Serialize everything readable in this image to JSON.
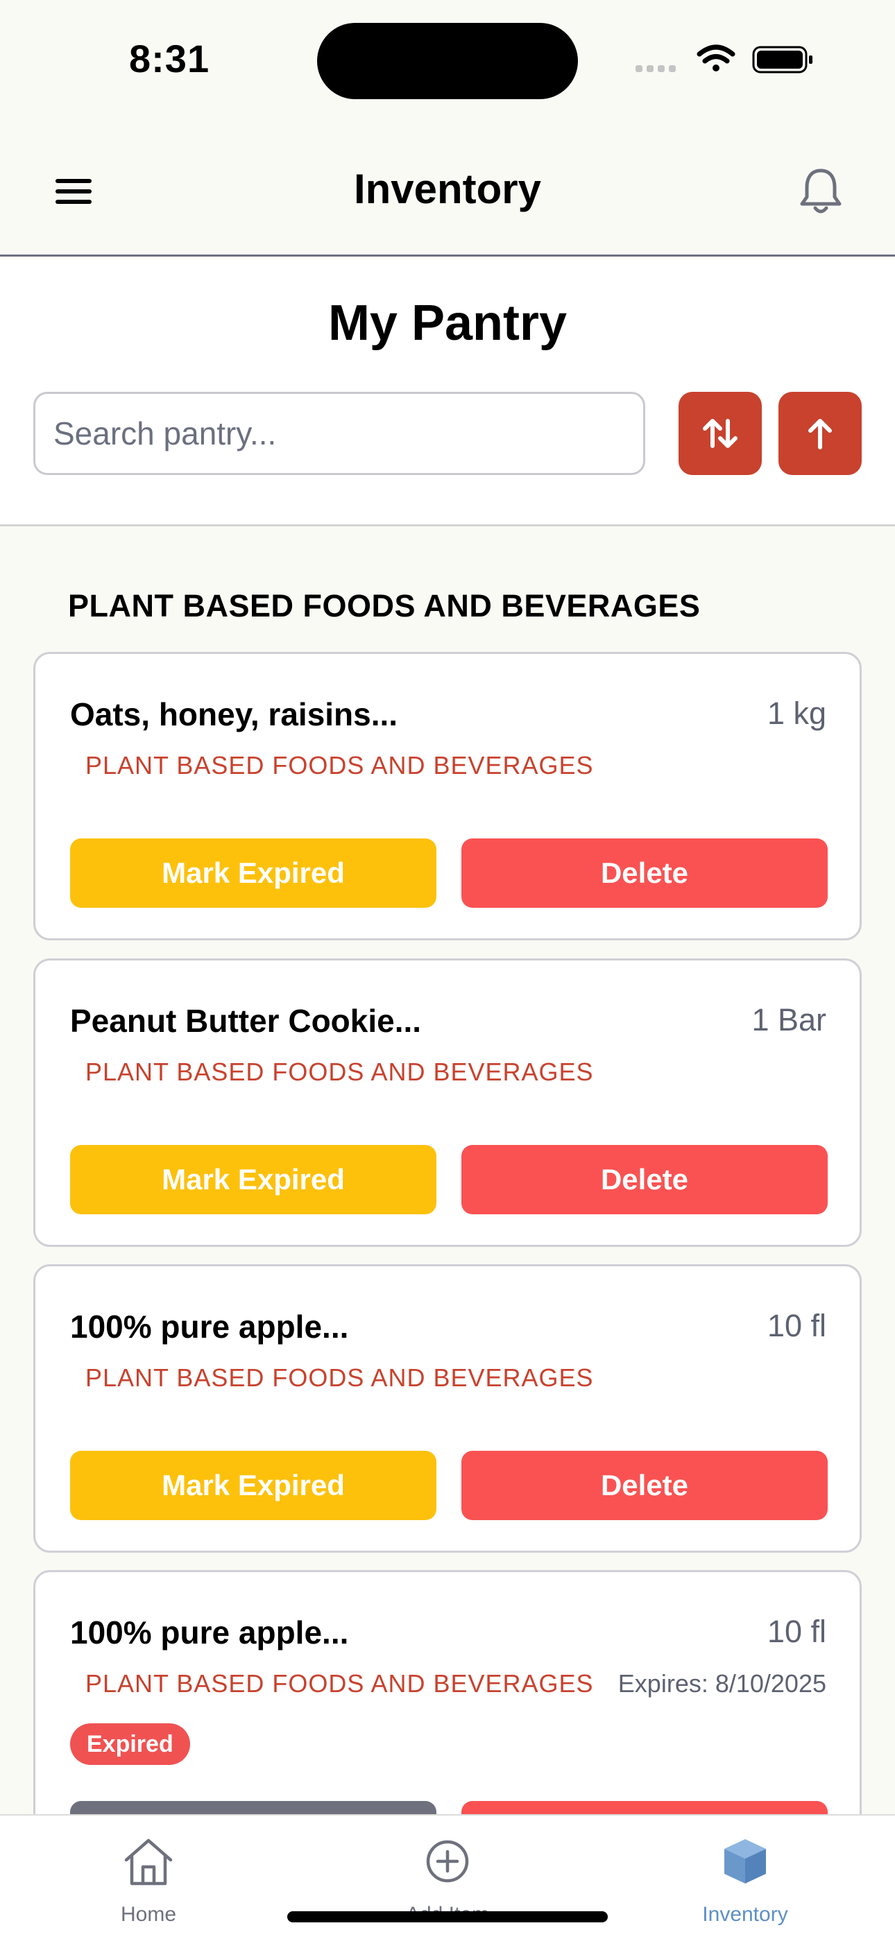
{
  "status_bar": {
    "time": "8:31"
  },
  "header": {
    "title": "Inventory"
  },
  "page": {
    "title": "My Pantry"
  },
  "search": {
    "placeholder": "Search pantry..."
  },
  "section": {
    "heading": "PLANT BASED FOODS AND BEVERAGES"
  },
  "items": [
    {
      "name": "Oats, honey, raisins...",
      "quantity": "1 kg",
      "category": "PLANT BASED FOODS AND BEVERAGES",
      "expire_label": "Mark Expired",
      "delete_label": "Delete"
    },
    {
      "name": "Peanut Butter Cookie...",
      "quantity": "1 Bar",
      "category": "PLANT BASED FOODS AND BEVERAGES",
      "expire_label": "Mark Expired",
      "delete_label": "Delete"
    },
    {
      "name": "100% pure apple...",
      "quantity": "10 fl",
      "category": "PLANT BASED FOODS AND BEVERAGES",
      "expire_label": "Mark Expired",
      "delete_label": "Delete"
    },
    {
      "name": "100% pure apple...",
      "quantity": "10 fl",
      "category": "PLANT BASED FOODS AND BEVERAGES",
      "expiry": "Expires: 8/10/2025",
      "badge": "Expired"
    }
  ],
  "tabs": [
    {
      "label": "Home",
      "icon": "home-icon"
    },
    {
      "label": "Add Item",
      "icon": "plus-circle-icon"
    },
    {
      "label": "Inventory",
      "icon": "cube-icon",
      "active": true
    }
  ],
  "colors": {
    "accent": "#c8422e",
    "mark_expired": "#fdc10c",
    "delete": "#fa5252",
    "active_tab": "#5e8fc4"
  }
}
